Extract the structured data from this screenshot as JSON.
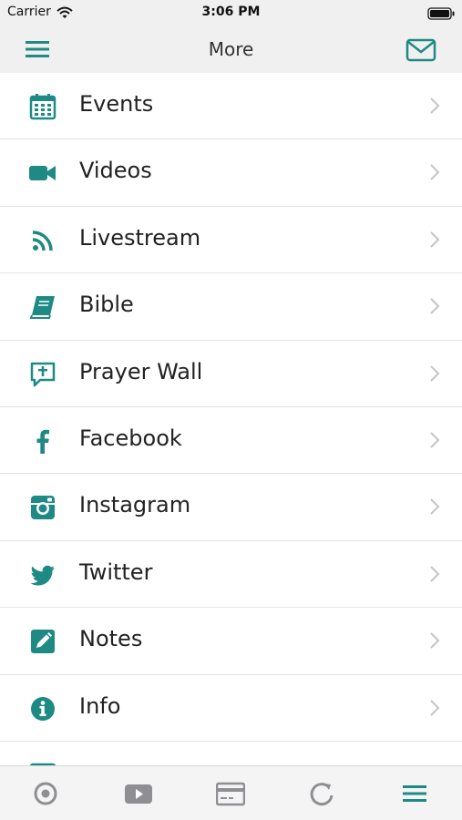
{
  "status_bar": {
    "carrier": "Carrier",
    "time": "3:06 PM"
  },
  "nav": {
    "title": "More",
    "left_icon": "hamburger-menu-icon",
    "right_icon": "envelope-icon"
  },
  "colors": {
    "accent": "#1f8a84",
    "chevron": "#c4c4cc",
    "tab_inactive": "#8e8e93",
    "separator": "#e3e3e3"
  },
  "menu": {
    "items": [
      {
        "label": "Events",
        "icon": "calendar-icon"
      },
      {
        "label": "Videos",
        "icon": "video-camera-icon"
      },
      {
        "label": "Livestream",
        "icon": "rss-icon"
      },
      {
        "label": "Bible",
        "icon": "book-icon"
      },
      {
        "label": "Prayer Wall",
        "icon": "prayer-bubble-icon"
      },
      {
        "label": "Facebook",
        "icon": "facebook-icon"
      },
      {
        "label": "Instagram",
        "icon": "instagram-icon"
      },
      {
        "label": "Twitter",
        "icon": "twitter-icon"
      },
      {
        "label": "Notes",
        "icon": "notes-pencil-icon"
      },
      {
        "label": "Info",
        "icon": "info-icon"
      },
      {
        "label": "",
        "icon": "partial-item-icon"
      }
    ]
  },
  "tabbar": {
    "tabs": [
      {
        "icon": "target-icon",
        "active": false
      },
      {
        "icon": "play-video-icon",
        "active": false
      },
      {
        "icon": "card-icon",
        "active": false
      },
      {
        "icon": "refresh-icon",
        "active": false
      },
      {
        "icon": "menu-icon",
        "active": true
      }
    ]
  }
}
